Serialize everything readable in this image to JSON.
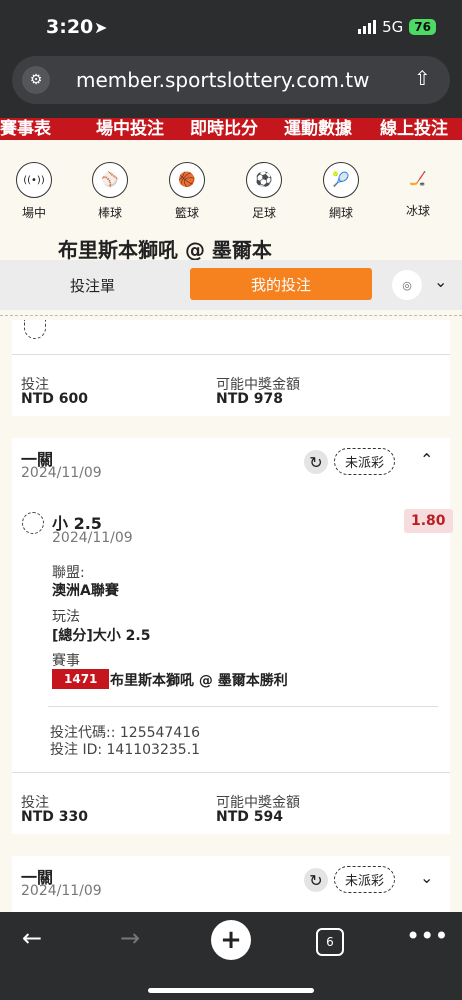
{
  "status": {
    "time": "3:20",
    "network": "5G",
    "battery": "76"
  },
  "browser": {
    "url": "member.sportslottery.com.tw",
    "tabs_count": "6"
  },
  "nav": [
    "賽事表",
    "場中投注",
    "即時比分",
    "運動數據",
    "線上投注"
  ],
  "sports": [
    {
      "label": "場中",
      "icon": "live-broadcast-icon",
      "glyph": "((•))"
    },
    {
      "label": "棒球",
      "icon": "baseball-icon",
      "glyph": "⚾"
    },
    {
      "label": "籃球",
      "icon": "basketball-icon",
      "glyph": "🏀"
    },
    {
      "label": "足球",
      "icon": "soccer-icon",
      "glyph": "⚽"
    },
    {
      "label": "網球",
      "icon": "tennis-icon",
      "glyph": "🎾"
    },
    {
      "label": "冰球",
      "icon": "ice-hockey-icon",
      "glyph": "🏒"
    }
  ],
  "match_title": "布里斯本獅吼 @ 墨爾本",
  "tabs": {
    "slip": "投注單",
    "my_bets": "我的投注"
  },
  "card0": {
    "stake_label": "投注",
    "stake": "NTD 600",
    "payout_label": "可能中獎金額",
    "payout": "NTD 978"
  },
  "card1": {
    "type": "一關",
    "date": "2024/11/09",
    "status": "未派彩",
    "selection": "小 2.5",
    "selection_date": "2024/11/09",
    "odds": "1.80",
    "league_label": "聯盟:",
    "league": "澳洲A聯賽",
    "market_label": "玩法",
    "market": "[總分]大小 2.5",
    "event_label": "賽事",
    "event_code": "1471",
    "event": "布里斯本獅吼 @ 墨爾本勝利",
    "bet_code": "投注代碼:: 125547416",
    "bet_id": "投注 ID: 141103235.1",
    "stake_label": "投注",
    "stake": "NTD 330",
    "payout_label": "可能中獎金額",
    "payout": "NTD 594"
  },
  "card2": {
    "type": "一關",
    "date": "2024/11/09",
    "status": "未派彩"
  }
}
